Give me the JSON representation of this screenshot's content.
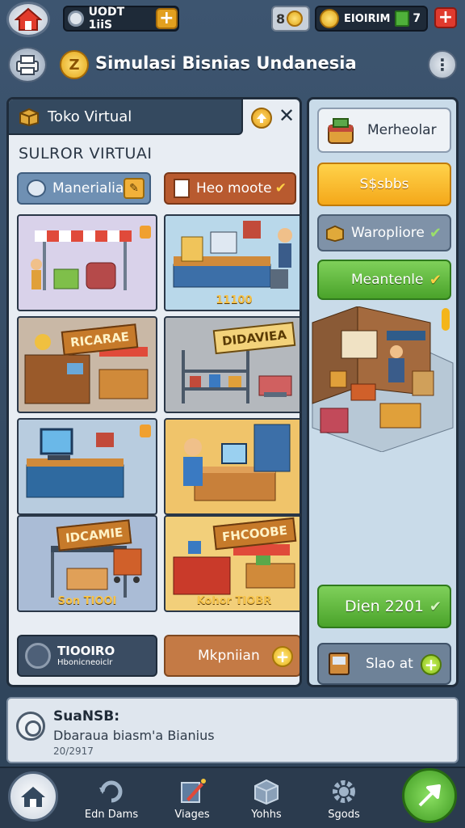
{
  "topbar": {
    "currency_label": "UODT 1iiS",
    "money_label": "EIOIRIM",
    "level_value": "7"
  },
  "titlebar": {
    "coin_glyph": "Z",
    "title": "Simulasi Bisnias Undanesia"
  },
  "panel": {
    "header_label": "Toko Virtual",
    "section_title": "SULROR VIRTUAI",
    "tab_a_label": "Manerialia",
    "tab_b_label": "Heo moote",
    "tiles": [
      {
        "label": ""
      },
      {
        "label": "11100"
      },
      {
        "label": ""
      },
      {
        "label": ""
      },
      {
        "label": ""
      },
      {
        "label": ""
      },
      {
        "label": "Son TIOOI"
      },
      {
        "label": "Kohor TIOBR"
      }
    ],
    "banners": [
      "RICARAE",
      "DIDAVIEA",
      "IDCAMIE",
      "FHCOOBE"
    ],
    "card_dark_title": "TIOOIRO",
    "card_dark_sub": "Hbonicneoiclr",
    "card_orange_label": "Mkpniian"
  },
  "right": {
    "btn1_label": "Merheolar",
    "btn2_label": "S$sbbs",
    "btn3_label": "Waropliore",
    "btn4_label": "Meantenle",
    "btn5_label": "Dien 2201",
    "btn6_label": "Slao at"
  },
  "notification": {
    "title": "SuaNSB:",
    "body": "Dbaraua biasm'a Bianius",
    "date": "20/2917"
  },
  "nav": {
    "item1": "Edn Dams",
    "item2": "Viages",
    "item3": "Yohhs",
    "item4": "Sgods"
  },
  "colors": {
    "accent_orange": "#b85a2f",
    "accent_green": "#4aa32a",
    "accent_yellow": "#f4a81a",
    "plus_red": "#e03a2e"
  }
}
